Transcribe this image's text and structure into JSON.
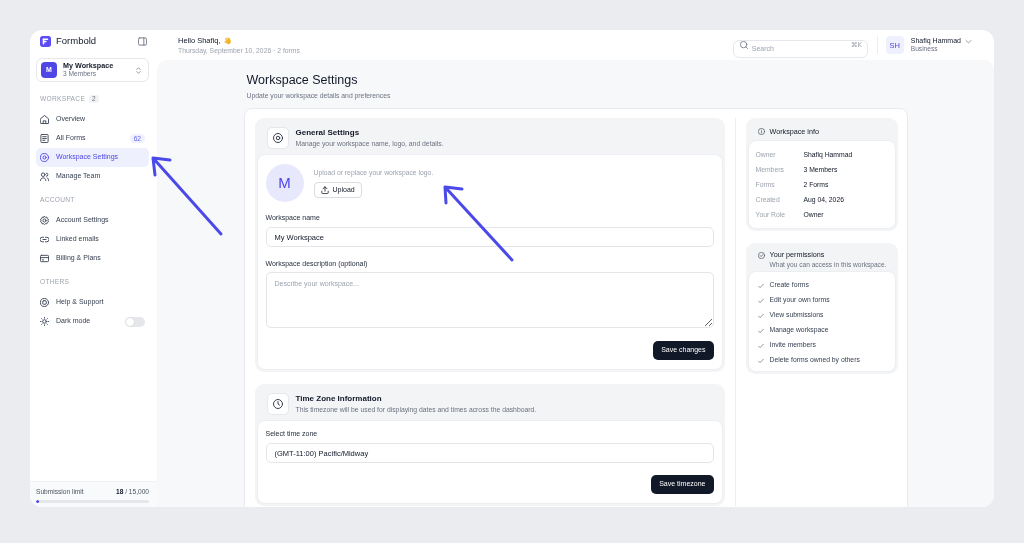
{
  "brand": {
    "name": "Formbold"
  },
  "workspace": {
    "initial": "M",
    "name": "My Workspace",
    "members": "3 Members"
  },
  "sidebar": {
    "sections": [
      {
        "label": "WORKSPACE",
        "count": "2",
        "items": [
          {
            "kind": "link",
            "label": "Overview",
            "selected": false
          },
          {
            "kind": "link",
            "label": "All Forms",
            "badge": "62",
            "selected": false
          },
          {
            "kind": "link",
            "label": "Workspace Settings",
            "selected": true
          },
          {
            "kind": "link",
            "label": "Manage Team",
            "selected": false
          }
        ]
      },
      {
        "label": "ACCOUNT",
        "items": [
          {
            "kind": "link",
            "label": "Account Settings",
            "selected": false
          },
          {
            "kind": "link",
            "label": "Linked emails",
            "selected": false
          },
          {
            "kind": "link",
            "label": "Billing & Plans",
            "selected": false
          }
        ]
      },
      {
        "label": "OTHERS",
        "items": [
          {
            "kind": "link",
            "label": "Help & Support",
            "selected": false
          },
          {
            "kind": "toggle",
            "label": "Dark mode",
            "on": false
          }
        ]
      }
    ]
  },
  "usage": {
    "label": "Submission limit",
    "count": "**18** / 15,000",
    "level": 0.03
  },
  "header": {
    "greeting": "Hello Shafiq,",
    "subtitle": "Thursday, September 10, 2026 · 2 forms",
    "search": {
      "placeholder": "Search",
      "shortcut": "⌘K"
    },
    "user": {
      "initials": "SH",
      "name": "Shafiq Hammad",
      "plan": "Business"
    }
  },
  "page": {
    "title": "Workspace Settings",
    "subtitle": "Update your workspace details and preferences"
  },
  "general_settings": {
    "title": "General Settings",
    "description": "Manage your workspace name, logo, and details.",
    "logo_initial": "M",
    "logo_hint": "Upload or replace your workspace logo.",
    "upload_button": "Upload",
    "fields": [
      {
        "kind": "input",
        "label": "Workspace name",
        "value": "My Workspace"
      },
      {
        "kind": "textarea",
        "label": "Workspace description (optional)",
        "placeholder": "Describe your workspace..."
      }
    ],
    "save_button": "Save changes"
  },
  "time_zone": {
    "title": "Time Zone Information",
    "description": "This timezone will be used for displaying dates and times across the dashboard.",
    "field": {
      "label": "Select time zone",
      "value": "(GMT-11:00) Pacific/Midway"
    },
    "save_button": "Save timezone"
  },
  "workspace_info": {
    "title": "Workspace info",
    "rows": [
      {
        "label": "Owner",
        "value": "Shafiq Hammad"
      },
      {
        "label": "Members",
        "value": "3 Members"
      },
      {
        "label": "Forms",
        "value": "2 Forms"
      },
      {
        "label": "Created",
        "value": "Aug 04, 2026"
      },
      {
        "label": "Your Role",
        "value": "Owner"
      }
    ]
  },
  "permissions": {
    "title": "Your permissions",
    "description": "What you can access in this workspace.",
    "items": [
      "Create forms",
      "Edit your own forms",
      "View submissions",
      "Manage workspace",
      "Invite members",
      "Delete forms owned by others"
    ]
  }
}
